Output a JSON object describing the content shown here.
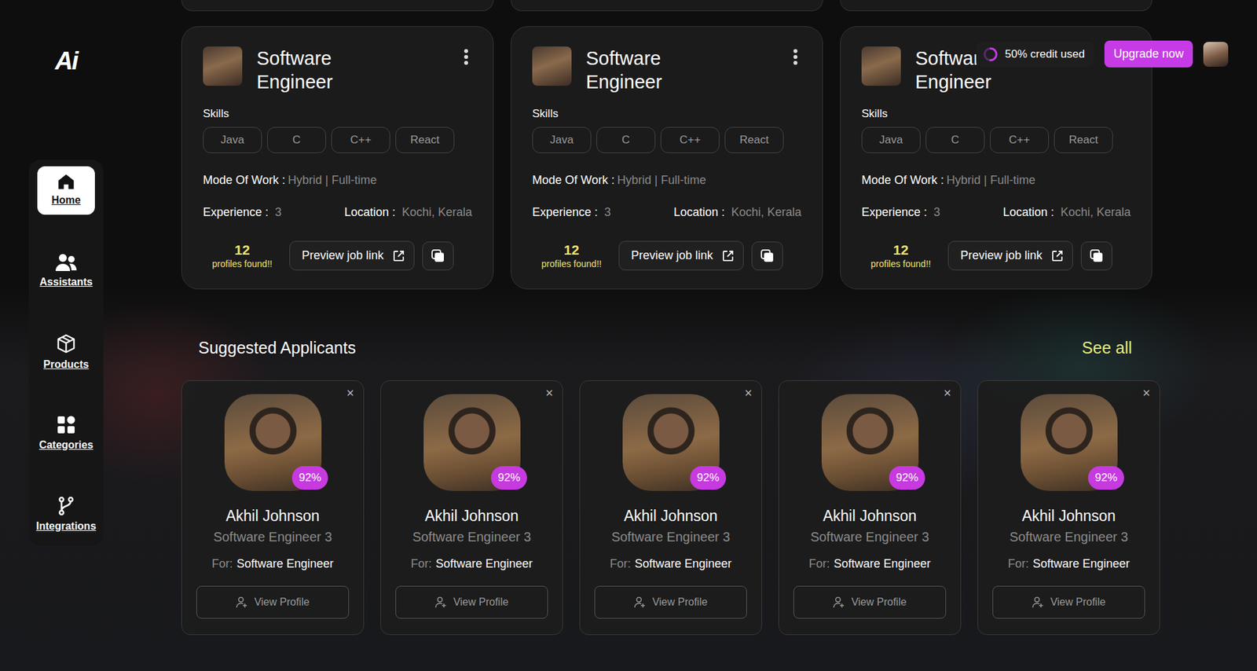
{
  "logo": "Ai",
  "sidebar": {
    "items": [
      {
        "label": "Home",
        "selected": true
      },
      {
        "label": "Assistants",
        "selected": false
      },
      {
        "label": "Products",
        "selected": false
      },
      {
        "label": "Categories",
        "selected": false
      },
      {
        "label": "Integrations",
        "selected": false
      }
    ]
  },
  "header": {
    "credit": {
      "label": "50% credit used",
      "level": 0.5
    },
    "upgrade_button": "Upgrade now"
  },
  "job_cards": [
    {
      "title": "Software Engineer",
      "skills_label": "Skills",
      "skills": [
        "Java",
        "C",
        "C++",
        "React"
      ],
      "mode_label": "Mode Of Work :",
      "mode": "Hybrid | Full-time",
      "experience_label": "Experience :",
      "experience": "3",
      "location_label": "Location :",
      "location": "Kochi, Kerala",
      "profiles_count": "12",
      "profiles_label": "profiles found!!",
      "preview_button": "Preview job link"
    },
    {
      "title": "Software Engineer",
      "skills_label": "Skills",
      "skills": [
        "Java",
        "C",
        "C++",
        "React"
      ],
      "mode_label": "Mode Of Work :",
      "mode": "Hybrid | Full-time",
      "experience_label": "Experience :",
      "experience": "3",
      "location_label": "Location :",
      "location": "Kochi, Kerala",
      "profiles_count": "12",
      "profiles_label": "profiles found!!",
      "preview_button": "Preview job link"
    },
    {
      "title": "Software Engineer",
      "skills_label": "Skills",
      "skills": [
        "Java",
        "C",
        "C++",
        "React"
      ],
      "mode_label": "Mode Of Work :",
      "mode": "Hybrid | Full-time",
      "experience_label": "Experience :",
      "experience": "3",
      "location_label": "Location :",
      "location": "Kochi, Kerala",
      "profiles_count": "12",
      "profiles_label": "profiles found!!",
      "preview_button": "Preview job link"
    }
  ],
  "suggested": {
    "title": "Suggested Applicants",
    "see_all": "See all",
    "applicants": [
      {
        "match": "92%",
        "name": "Akhil Johnson",
        "role": "Software Engineer 3",
        "for_label": "For:",
        "for": "Software Engineer",
        "view_button": "View Profile",
        "close": "×"
      },
      {
        "match": "92%",
        "name": "Akhil Johnson",
        "role": "Software Engineer 3",
        "for_label": "For:",
        "for": "Software Engineer",
        "view_button": "View Profile",
        "close": "×"
      },
      {
        "match": "92%",
        "name": "Akhil Johnson",
        "role": "Software Engineer 3",
        "for_label": "For:",
        "for": "Software Engineer",
        "view_button": "View Profile",
        "close": "×"
      },
      {
        "match": "92%",
        "name": "Akhil Johnson",
        "role": "Software Engineer 3",
        "for_label": "For:",
        "for": "Software Engineer",
        "view_button": "View Profile",
        "close": "×"
      },
      {
        "match": "92%",
        "name": "Akhil Johnson",
        "role": "Software Engineer 3",
        "for_label": "For:",
        "for": "Software Engineer",
        "view_button": "View Profile",
        "close": "×"
      }
    ]
  }
}
